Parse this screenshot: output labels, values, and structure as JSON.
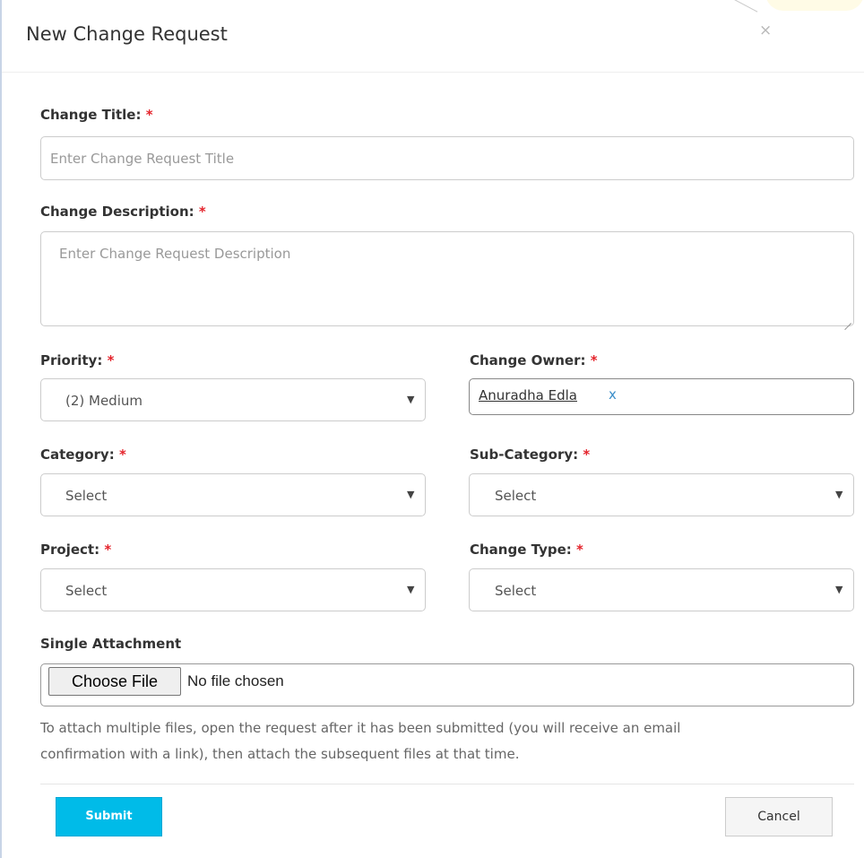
{
  "dialog": {
    "title": "New Change Request",
    "close_label": "×"
  },
  "form": {
    "required_marker": "*",
    "change_title": {
      "label": "Change Title:",
      "placeholder": "Enter Change Request Title"
    },
    "change_description": {
      "label": "Change Description:",
      "placeholder": "Enter Change Request Description"
    },
    "priority": {
      "label": "Priority:",
      "value": "(2) Medium"
    },
    "change_owner": {
      "label": "Change Owner:",
      "value": "Anuradha Edla",
      "remove_label": "x"
    },
    "category": {
      "label": "Category:",
      "value": "Select"
    },
    "sub_category": {
      "label": "Sub-Category:",
      "value": "Select"
    },
    "project": {
      "label": "Project:",
      "value": "Select"
    },
    "change_type": {
      "label": "Change Type:",
      "value": "Select"
    },
    "attachment": {
      "label": "Single Attachment",
      "button_label": "Choose File",
      "status": "No file chosen",
      "help_line1": "To attach multiple files, open the request after it has been submitted (you will receive an email",
      "help_line2": "confirmation with a link), then attach the subsequent files at that time."
    }
  },
  "footer": {
    "submit_label": "Submit",
    "cancel_label": "Cancel"
  },
  "colors": {
    "required": "#e4232b",
    "submit_bg": "#00bbe8",
    "owner_remove": "#3a8ec9"
  },
  "icons": {
    "close": "close-icon",
    "dropdown": "chevron-down-icon",
    "resize": "resize-handle-icon"
  }
}
